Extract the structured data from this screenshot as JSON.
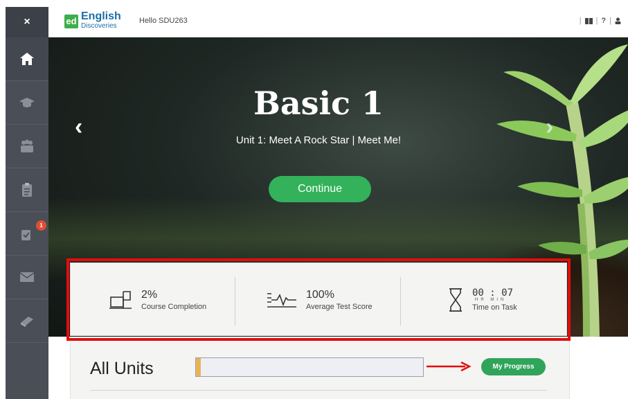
{
  "header": {
    "close_label": "×",
    "logo_badge": "ed",
    "logo_line1": "English",
    "logo_line2": "Discoveries",
    "greeting": "Hello SDU263",
    "icons": [
      "book-icon",
      "help-icon",
      "user-icon"
    ],
    "help_symbol": "?"
  },
  "sidebar": {
    "items": [
      {
        "name": "home-icon",
        "active": true
      },
      {
        "name": "graduation-cap-icon"
      },
      {
        "name": "community-icon"
      },
      {
        "name": "clipboard-icon"
      },
      {
        "name": "assignments-icon",
        "badge": "1"
      },
      {
        "name": "mail-icon"
      },
      {
        "name": "book-icon"
      }
    ]
  },
  "hero": {
    "title": "Basic 1",
    "subtitle": "Unit 1: Meet A Rock Star  |  Meet Me!",
    "continue_label": "Continue",
    "prev_arrow": "‹",
    "next_arrow": "›"
  },
  "stats": {
    "completion_value": "2%",
    "completion_label": "Course Completion",
    "score_value": "100%",
    "score_label": "Average Test Score",
    "time_value": "00 : 07",
    "time_hr": "HR",
    "time_min": "MIN",
    "time_label": "Time on Task"
  },
  "units": {
    "title": "All Units",
    "progress_fraction": 0.02,
    "my_progress_label": "My Progress"
  },
  "colors": {
    "sidebar": "#4a4e57",
    "accent_green": "#33b25b",
    "highlight_red": "#e30d0d",
    "logo_blue": "#1b6ea8"
  }
}
